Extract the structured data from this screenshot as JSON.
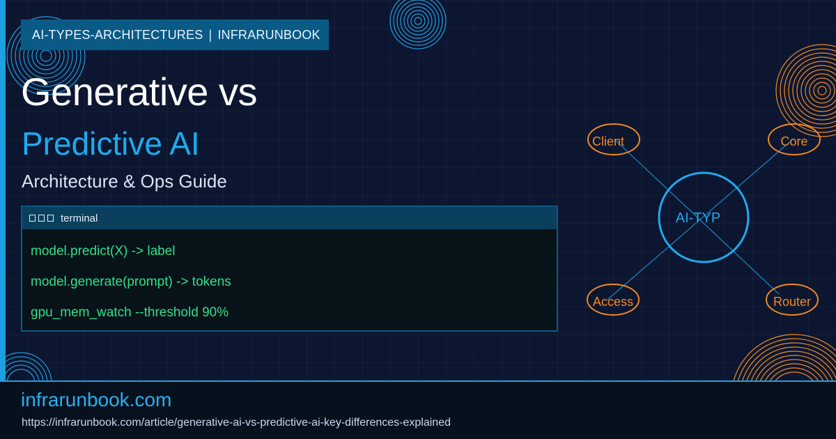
{
  "tag": {
    "category": "AI-TYPES-ARCHITECTURES",
    "separator": "|",
    "site": "INFRARUNBOOK"
  },
  "title": "Generative vs",
  "subtitle": "Predictive AI",
  "tagline": "Architecture & Ops Guide",
  "terminal": {
    "title": "terminal",
    "lines": [
      "model.predict(X) -> label",
      "model.generate(prompt) -> tokens",
      "gpu_mem_watch --threshold 90%"
    ]
  },
  "diagram": {
    "center": "AI-TYP",
    "nodes": [
      "Client",
      "Core",
      "Access",
      "Router"
    ]
  },
  "footer": {
    "domain": "infrarunbook.com",
    "url": "https://infrarunbook.com/article/generative-ai-vs-predictive-ai-key-differences-explained"
  },
  "colors": {
    "accent_blue": "#1eaaf0",
    "accent_orange": "#f08a24",
    "terminal_green": "#2fe089",
    "tag_bg": "#0a5a86"
  }
}
